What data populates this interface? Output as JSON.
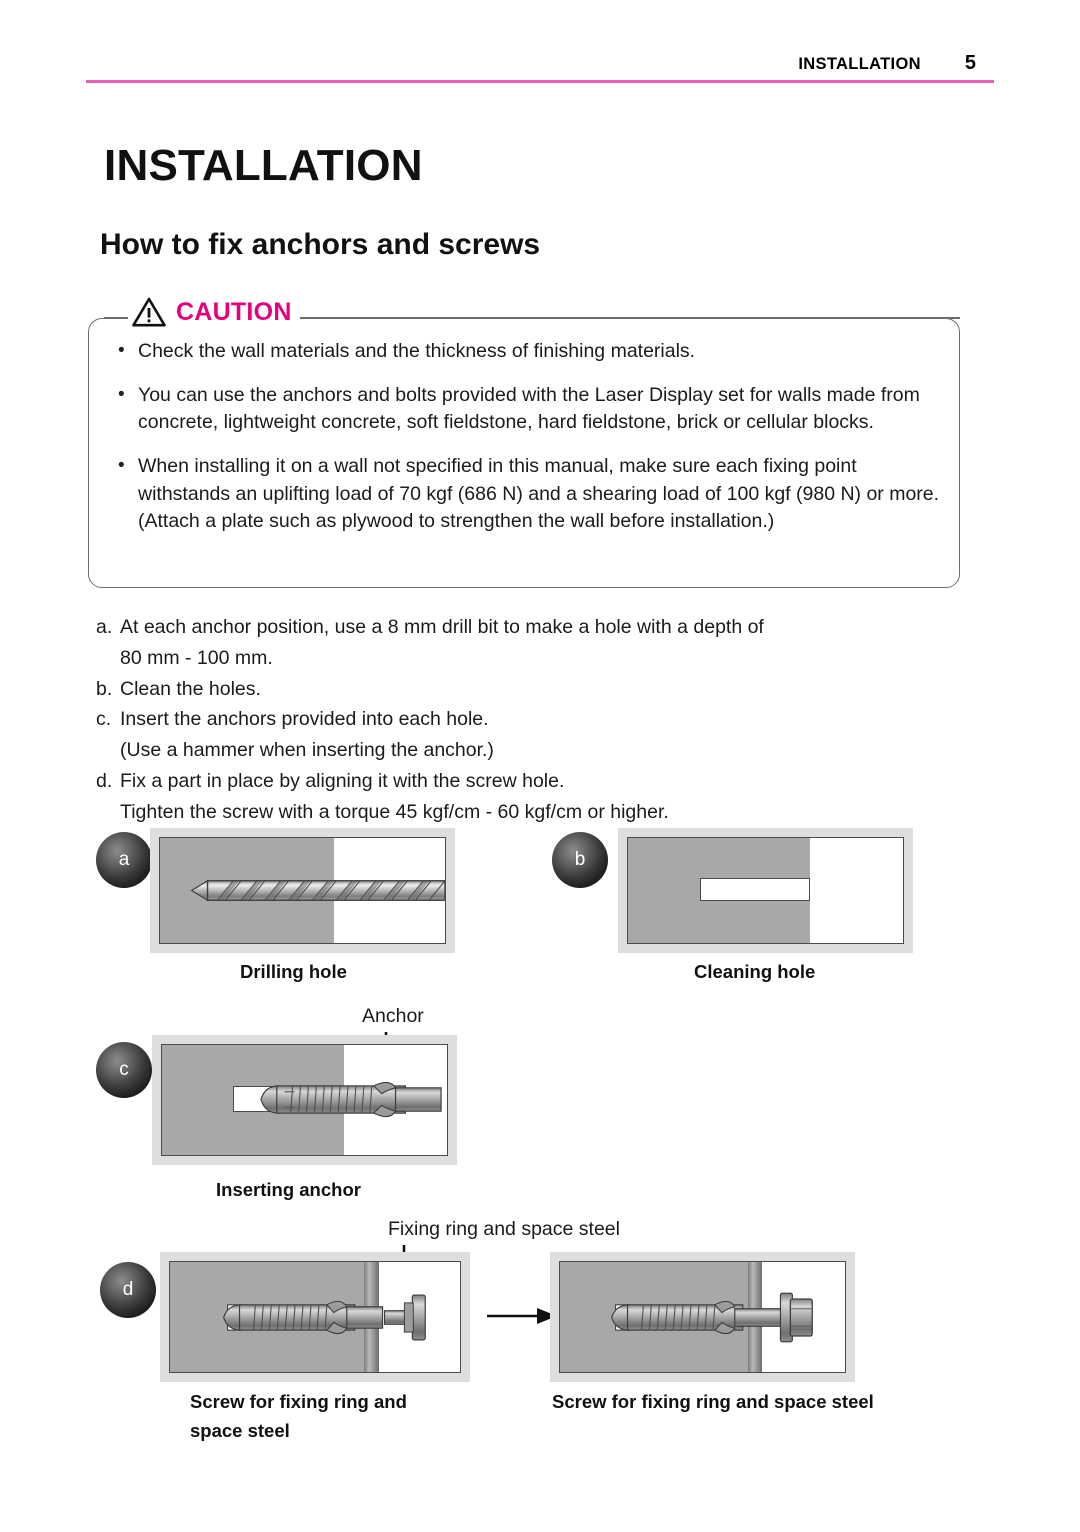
{
  "header": {
    "section": "INSTALLATION",
    "page_number": "5",
    "rule_color": "#ea5fb8"
  },
  "title": "INSTALLATION",
  "subtitle": "How to fix anchors and screws",
  "caution": {
    "label": "CAUTION",
    "label_color": "#e6007e",
    "icon": "warning-triangle-icon",
    "bullets": [
      "Check the wall materials and the thickness of finishing materials.",
      "You can use the anchors and bolts provided with the Laser Display set for walls made from concrete, lightweight concrete, soft fieldstone, hard fieldstone, brick or cellular blocks.",
      "When installing it on a wall not specified in this manual, make sure each fixing point withstands an uplifting load of 70 kgf (686 N) and a shearing load of 100 kgf (980 N) or more.\n(Attach a plate such as plywood to strengthen the wall before installation.)"
    ],
    "bullet3_line1": "When installing it on a wall not specified in this manual, make sure each fixing point withstands an uplifting load of 70 kgf (686 N) and a shearing load of 100 kgf (980 N) or more.",
    "bullet3_line2": "(Attach a plate such as plywood to strengthen the wall before installation.)"
  },
  "steps": [
    {
      "letter": "a.",
      "text": "At each anchor position, use a 8 mm drill bit to make a hole with a depth of",
      "cont": "80 mm - 100 mm."
    },
    {
      "letter": "b.",
      "text": "Clean the holes.",
      "cont": ""
    },
    {
      "letter": "c.",
      "text": "Insert the anchors provided into each hole.",
      "cont": "(Use a hammer when inserting the anchor.)"
    },
    {
      "letter": "d.",
      "text": "Fix a part in place by aligning it with the screw hole.",
      "cont": "Tighten the screw with a torque 45 kgf/cm - 60 kgf/cm or higher."
    }
  ],
  "figures": {
    "a": {
      "badge": "a",
      "caption": "Drilling hole"
    },
    "b": {
      "badge": "b",
      "caption": "Cleaning hole"
    },
    "c": {
      "badge": "c",
      "caption": "Inserting anchor",
      "callout": "Anchor"
    },
    "d": {
      "badge": "d",
      "caption_left_line1": "Screw for fixing ring and",
      "caption_left_line2": "space steel",
      "caption_right": "Screw for fixing ring and space steel",
      "callout": "Fixing ring and space steel"
    }
  }
}
